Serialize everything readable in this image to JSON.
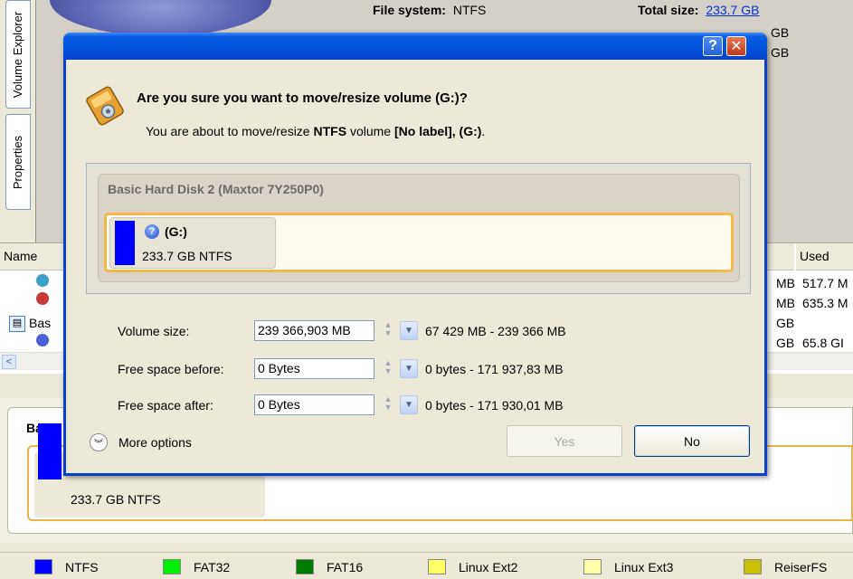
{
  "background": {
    "side_tabs": [
      "Volume Explorer",
      "Properties"
    ],
    "info": {
      "file_system_label": "File system:",
      "file_system_value": "NTFS",
      "total_size_label": "Total size:",
      "total_size_value": "233.7 GB",
      "partial_line1": "GB",
      "partial_line2": "GB"
    },
    "list": {
      "name_header": "Name",
      "used_header": "Used",
      "row_bas": "Bas",
      "right_rows": [
        {
          "unit": "MB",
          "used": "517.7 M"
        },
        {
          "unit": "MB",
          "used": "635.3 M"
        },
        {
          "unit": "GB",
          "used": ""
        },
        {
          "unit": "GB",
          "used": "65.8 GI"
        }
      ]
    },
    "lower": {
      "title": "Basi",
      "volume_size": "233.7 GB NTFS"
    },
    "legend": [
      {
        "label": "NTFS",
        "color": "#0000ff"
      },
      {
        "label": "FAT32",
        "color": "#00ee00"
      },
      {
        "label": "FAT16",
        "color": "#007a00"
      },
      {
        "label": "Linux Ext2",
        "color": "#ffff66"
      },
      {
        "label": "Linux Ext3",
        "color": "#ffffaa"
      },
      {
        "label": "ReiserFS",
        "color": "#c8c000"
      }
    ]
  },
  "dialog": {
    "help_glyph": "?",
    "close_glyph": "✕",
    "question": "Are you sure you want to move/resize volume (G:)?",
    "sub_prefix": "You are about to move/resize ",
    "sub_fs": "NTFS",
    "sub_mid": " volume ",
    "sub_vol": "[No label], (G:)",
    "sub_end": ".",
    "disk_title": "Basic Hard Disk 2 (Maxtor 7Y250P0)",
    "volume_letter": "(G:)",
    "volume_size": "233.7 GB NTFS",
    "volume_color": "#0000ff",
    "fields": [
      {
        "label": "Volume size:",
        "value": "239 366,903 MB",
        "range": "67 429 MB - 239 366 MB"
      },
      {
        "label": "Free space before:",
        "value": "0 Bytes",
        "range": "0 bytes - 171 937,83 MB"
      },
      {
        "label": "Free space after:",
        "value": "0 Bytes",
        "range": "0 bytes - 171 930,01 MB"
      }
    ],
    "more_options": "More options",
    "yes_label": "Yes",
    "no_label": "No"
  }
}
